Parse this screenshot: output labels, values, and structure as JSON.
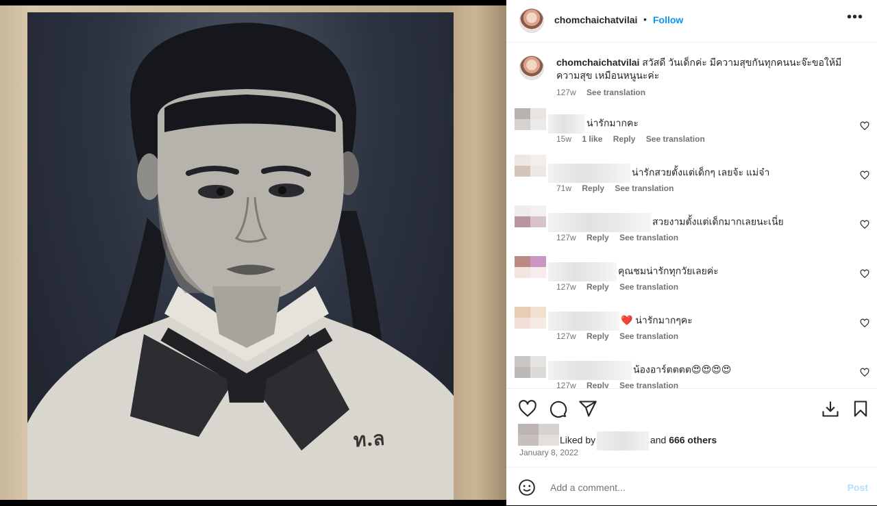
{
  "post": {
    "username": "chomchaichatvilai",
    "separator": "•",
    "follow_label": "Follow",
    "more_label": "•••",
    "photo_badge": "ท.ล",
    "caption": {
      "username": "chomchaichatvilai",
      "text": "สวัสดี วันเด็กค่ะ มีความสุขกันทุกคนนะจ๊ะขอให้มีความสุข เหมือนหนูนะค่ะ",
      "age": "127w",
      "see_translation": "See translation"
    },
    "comments": [
      {
        "text": "น่ารักมากคะ",
        "age": "15w",
        "likes": "1 like",
        "reply": "Reply",
        "see_translation": "See translation"
      },
      {
        "text": "น่ารักสวยตั้งแต่เด็กๆ เลยจ้ะ แม่จ๋า",
        "age": "71w",
        "reply": "Reply",
        "see_translation": "See translation"
      },
      {
        "text": "สวยงามตั้งแต่เด็กมากเลยนะเนี่ย",
        "age": "127w",
        "reply": "Reply",
        "see_translation": "See translation"
      },
      {
        "text": "คุณชมน่ารักทุกวัยเลยค่ะ",
        "age": "127w",
        "reply": "Reply",
        "see_translation": "See translation"
      },
      {
        "text": "❤️ น่ารักมากๆคะ",
        "age": "127w",
        "reply": "Reply",
        "see_translation": "See translation"
      },
      {
        "text": "น้องอาร์ตตตต😍😍😍😍",
        "age": "127w",
        "reply": "Reply",
        "see_translation": "See translation"
      }
    ],
    "actions": {
      "like_icon": "heart-icon",
      "comment_icon": "comment-icon",
      "share_icon": "send-icon",
      "download_icon": "download-icon",
      "save_icon": "bookmark-icon"
    },
    "liked_by_prefix": "Liked by",
    "liked_by_and": "and",
    "liked_by_others": "666 others",
    "date": "January 8, 2022",
    "comment_placeholder": "Add a comment...",
    "post_label": "Post"
  },
  "colors": {
    "accent": "#0095f6",
    "post_disabled": "#b2dffc",
    "meta": "#737373"
  }
}
